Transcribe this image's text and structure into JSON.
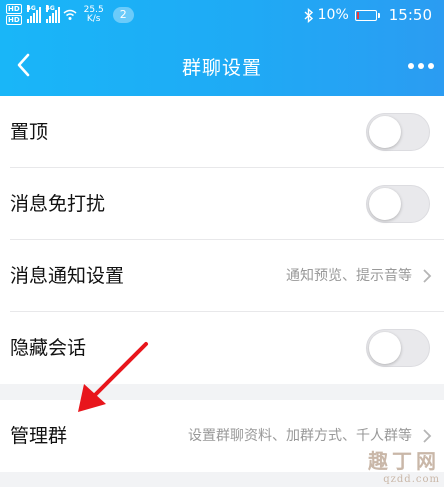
{
  "status_bar": {
    "sim1_tag": "HD",
    "sim2_tag": "HD",
    "net1": "4G",
    "net2": "4G",
    "speed_value": "25.5",
    "speed_unit": "K/s",
    "notification_count": "2",
    "bluetooth": "bluetooth-icon",
    "battery_percent": "10%",
    "battery_level": 0.1,
    "time": "15:50"
  },
  "nav": {
    "title": "群聊设置",
    "back_icon": "chevron-left-icon",
    "more_icon": "more-dots-icon"
  },
  "settings": {
    "pin": {
      "label": "置顶",
      "enabled": false
    },
    "mute": {
      "label": "消息免打扰",
      "enabled": false
    },
    "notify": {
      "label": "消息通知设置",
      "detail": "通知预览、提示音等"
    },
    "hide": {
      "label": "隐藏会话",
      "enabled": false
    },
    "manage": {
      "label": "管理群",
      "detail": "设置群聊资料、加群方式、千人群等"
    }
  },
  "watermark": {
    "line1": "趣丁网",
    "line2": "qzdd.com"
  },
  "colors": {
    "header_start": "#19b6f8",
    "header_end": "#2b9cf2",
    "annotation_arrow": "#e8161c",
    "battery_low": "#e8383d"
  }
}
